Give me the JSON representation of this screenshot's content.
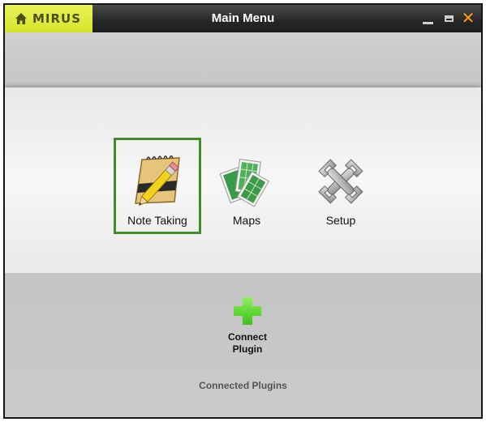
{
  "titlebar": {
    "brand": "MIRUS",
    "title": "Main Menu",
    "brand_color": "#dbe834",
    "close_color": "#ff9a1e",
    "icons": [
      "home-icon",
      "minimize-icon",
      "maximize-icon",
      "close-icon"
    ]
  },
  "menu": {
    "items": [
      {
        "label": "Note Taking",
        "icon": "notepad-pencil-icon",
        "selected": true
      },
      {
        "label": "Maps",
        "icon": "maps-icon",
        "selected": false
      },
      {
        "label": "Setup",
        "icon": "wrench-tools-icon",
        "selected": false
      }
    ],
    "selection_color": "#3f8e2a"
  },
  "plugins": {
    "connect_label_line1": "Connect",
    "connect_label_line2": "Plugin",
    "connect_icon": "plus-icon",
    "connect_icon_color": "#5ad82e",
    "connected_label": "Connected Plugins"
  }
}
